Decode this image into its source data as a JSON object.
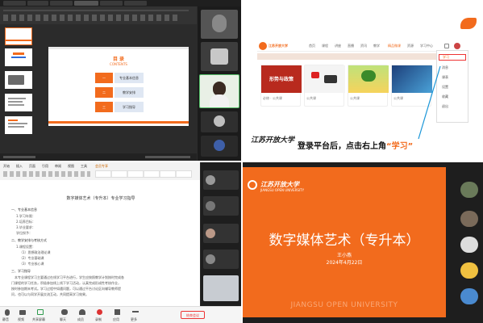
{
  "top_left": {
    "tabs": [
      "",
      "",
      "",
      "",
      "",
      ""
    ],
    "slide": {
      "title": "目 录",
      "subtitle": "CONTENTS",
      "items": [
        {
          "num": "一",
          "label": "专业基本信息"
        },
        {
          "num": "二",
          "label": "教学安排"
        },
        {
          "num": "三",
          "label": "学习指导"
        }
      ]
    }
  },
  "top_right": {
    "logo_text": "江苏开放大学",
    "nav_items": [
      "首页",
      "课程",
      "讲座",
      "直播",
      "资讯",
      "教学",
      "精品微课",
      "资源",
      "学习中心"
    ],
    "course_cards": [
      {
        "title": "形势与政策",
        "meta": "必修 · 公共课"
      },
      {
        "title": "",
        "meta": "公共课"
      },
      {
        "title": "",
        "meta": "公共课"
      },
      {
        "title": "",
        "meta": "公共课"
      }
    ],
    "dropdown_items": [
      "学习",
      "消息",
      "课表",
      "设置",
      "收藏",
      "退出"
    ],
    "school_seal": "江苏开放大学",
    "instruction_text": "登录平台后，点击右上角",
    "instruction_highlight": "“学习”"
  },
  "bottom_left": {
    "toolbar_tabs": [
      "开始",
      "插入",
      "页面",
      "引用",
      "审阅",
      "视图",
      "工具",
      "会员专享"
    ],
    "doc_title": "数字媒体艺术（专升本）专业学习指导",
    "section1": "一、专业基本信息",
    "lines1": [
      "1.学习年限：",
      "2.培养目标：",
      "3.毕业要求：",
      "学位授予："
    ],
    "section2": "二、教学安排与考核方式",
    "lines2": [
      "1.课程设置：",
      "（1）思想政治理论课",
      "（2）专业基础课",
      "（3）专业核心课"
    ],
    "section3": "三、学习指导",
    "para": [
      "本专业课程学习主要通过在线学习平台进行，学生应按照教学计划按时完成各",
      "门课程的学习任务，积极参加线上线下学习活动，认真完成形成性考核作业，",
      "按时参加期末考试。学习过程中如遇问题，可以通过平台讨论区向辅导教师提",
      "问，也可以与同学开展交流互动，共同提高学习效果。"
    ],
    "bottom_bar": [
      "静音",
      "视频",
      "共享屏幕",
      "聊天",
      "成员",
      "录制",
      "应用",
      "更多"
    ],
    "end_button": "结束会议",
    "participants": [
      "",
      "",
      "",
      ""
    ]
  },
  "bottom_right": {
    "slide_logo": "江苏开放大学",
    "slide_logo_en": "JIANGSU OPEN UNIVERSITY",
    "slide_title": "数字媒体艺术（专升本）",
    "slide_author": "王小燕",
    "slide_date": "2024年4月22日",
    "slide_footer": "JIANGSU OPEN UNIVERSITY",
    "participants": [
      "",
      "",
      "",
      "",
      "",
      "",
      ""
    ]
  },
  "colors": {
    "accent": "#f26b1d",
    "blue": "#2f6bd8",
    "link": "#1a96d8"
  }
}
